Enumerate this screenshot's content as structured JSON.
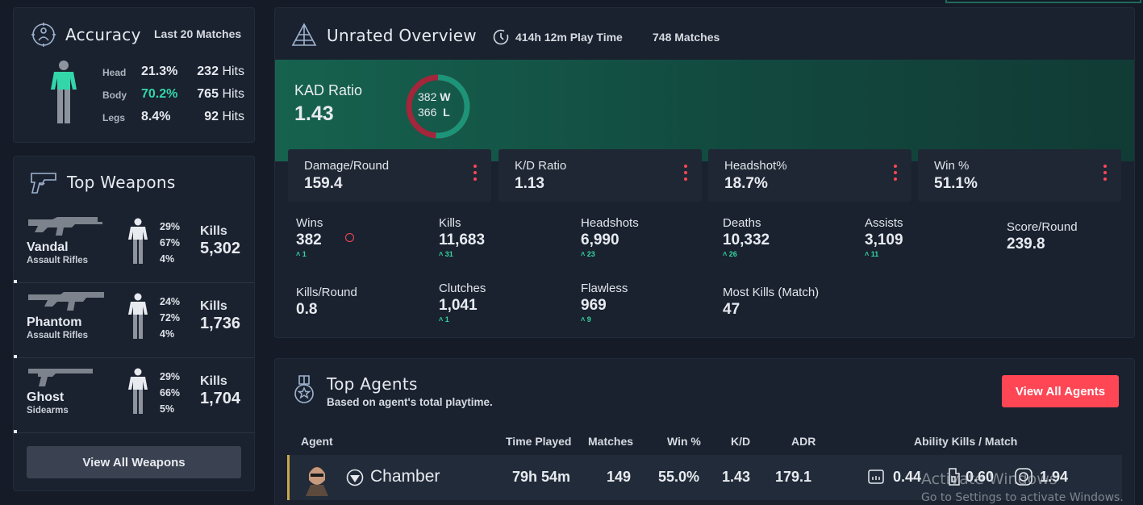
{
  "accuracy": {
    "title": "Accuracy",
    "subtitle": "Last 20 Matches",
    "rows": [
      {
        "label": "Head",
        "pct": "21.3%",
        "hits": "232",
        "unit": "Hits"
      },
      {
        "label": "Body",
        "pct": "70.2%",
        "hits": "765",
        "unit": "Hits"
      },
      {
        "label": "Legs",
        "pct": "8.4%",
        "hits": "92",
        "unit": "Hits"
      }
    ],
    "highlight_color": "#33d6a9"
  },
  "weapons": {
    "title": "Top Weapons",
    "kills_label": "Kills",
    "items": [
      {
        "name": "Vandal",
        "type": "Assault Rifles",
        "head": "29%",
        "body": "67%",
        "legs": "4%",
        "kills": "5,302"
      },
      {
        "name": "Phantom",
        "type": "Assault Rifles",
        "head": "24%",
        "body": "72%",
        "legs": "4%",
        "kills": "1,736"
      },
      {
        "name": "Ghost",
        "type": "Sidearms",
        "head": "29%",
        "body": "66%",
        "legs": "5%",
        "kills": "1,704"
      }
    ],
    "view_all": "View All Weapons"
  },
  "overview": {
    "title": "Unrated Overview",
    "playtime": "414h 12m Play Time",
    "matches": "748 Matches",
    "kad_label": "KAD Ratio",
    "kad_value": "1.43",
    "wins_w": "382",
    "losses_l": "366",
    "w_suffix": "W",
    "l_suffix": "L",
    "win_fraction": 0.511,
    "boxes": [
      {
        "label": "Damage/Round",
        "value": "159.4"
      },
      {
        "label": "K/D Ratio",
        "value": "1.13"
      },
      {
        "label": "Headshot%",
        "value": "18.7%"
      },
      {
        "label": "Win %",
        "value": "51.1%"
      }
    ],
    "stats": [
      {
        "label": "Wins",
        "value": "382",
        "delta": "1"
      },
      {
        "label": "Kills",
        "value": "11,683",
        "delta": "31"
      },
      {
        "label": "Headshots",
        "value": "6,990",
        "delta": "23"
      },
      {
        "label": "Deaths",
        "value": "10,332",
        "delta": "26"
      },
      {
        "label": "Assists",
        "value": "3,109",
        "delta": "11"
      },
      {
        "label": "Score/Round",
        "value": "239.8",
        "delta": ""
      },
      {
        "label": "Kills/Round",
        "value": "0.8",
        "delta": ""
      },
      {
        "label": "Clutches",
        "value": "1,041",
        "delta": "1"
      },
      {
        "label": "Flawless",
        "value": "969",
        "delta": "9"
      },
      {
        "label": "Most Kills (Match)",
        "value": "47",
        "delta": ""
      }
    ],
    "accent": "#ff4655",
    "up_color": "#33d69f"
  },
  "agents": {
    "title": "Top Agents",
    "subtitle": "Based on agent's total playtime.",
    "view_all": "View All Agents",
    "headers": [
      "Agent",
      "Time Played",
      "Matches",
      "Win %",
      "K/D",
      "ADR",
      "Ability Kills / Match"
    ],
    "rows": [
      {
        "name": "Chamber",
        "time": "79h 54m",
        "matches": "149",
        "win": "55.0%",
        "kd": "1.43",
        "adr": "179.1",
        "ab1": "0.44",
        "ab2": "0.60",
        "ab3": "1.94"
      }
    ]
  },
  "watermark": {
    "line1": "Activate Windows",
    "line2": "Go to Settings to activate Windows."
  }
}
